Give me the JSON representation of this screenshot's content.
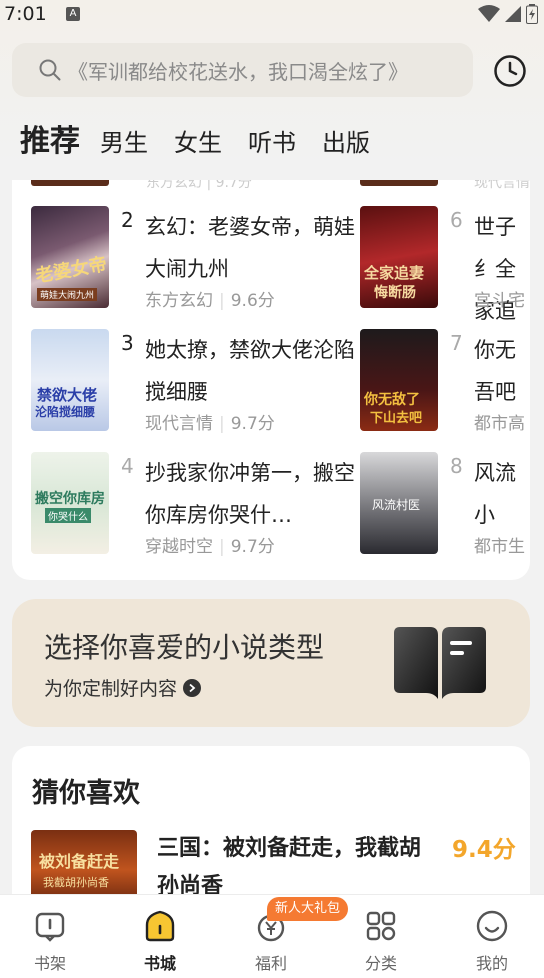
{
  "status_bar": {
    "time": "7:01",
    "notification_badge": "A"
  },
  "search": {
    "placeholder": "《军训都给校花送水，我口渴全炫了》"
  },
  "tabs": [
    {
      "label": "推荐",
      "active": true
    },
    {
      "label": "男生"
    },
    {
      "label": "女生"
    },
    {
      "label": "听书"
    },
    {
      "label": "出版"
    }
  ],
  "ranking": {
    "peek_left_meta": "东方玄幻 | 9.7分",
    "peek_right_meta": "现代言情",
    "left": [
      {
        "rank": "2",
        "title": "玄幻：老婆女帝，萌娃大闹九州",
        "genre": "东方玄幻",
        "score": "9.6分",
        "cover_text": "老婆女帝",
        "cover_sub": "萌娃大闹九州"
      },
      {
        "rank": "3",
        "title": "她太撩，禁欲大佬沦陷搅细腰",
        "genre": "现代言情",
        "score": "9.7分",
        "cover_text": "禁欲大佬",
        "cover_sub": "沦陷搅细腰"
      },
      {
        "rank": "4",
        "title": "抄我家你冲第一，搬空你库房你哭什…",
        "genre": "穿越时空",
        "score": "9.7分",
        "cover_text": "搬空你库房",
        "cover_sub": "你哭什么"
      }
    ],
    "right": [
      {
        "rank": "6",
        "title": "世子纟全家追",
        "genre": "宫斗宅",
        "cover_text": "全家追妻",
        "cover_sub": "悔断肠"
      },
      {
        "rank": "7",
        "title": "你无吾吧",
        "genre": "都市高",
        "cover_text": "你无敌了",
        "cover_sub": "下山去吧"
      },
      {
        "rank": "8",
        "title": "风流小",
        "genre": "都市生",
        "cover_text": "风流村医",
        "cover_sub": ""
      }
    ]
  },
  "category_banner": {
    "title": "选择你喜爱的小说类型",
    "subtitle": "为你定制好内容"
  },
  "guess": {
    "heading": "猜你喜欢",
    "book": {
      "title": "三国：被刘备赶走，我截胡孙尚香",
      "score": "9.4分",
      "cover_text": "被刘备赶走",
      "cover_sub": "我截胡孙尚香"
    }
  },
  "bottom_nav": {
    "badge": "新人大礼包",
    "items": [
      {
        "label": "书架",
        "icon": "bookshelf-icon"
      },
      {
        "label": "书城",
        "icon": "bookstore-icon",
        "active": true
      },
      {
        "label": "福利",
        "icon": "welfare-icon"
      },
      {
        "label": "分类",
        "icon": "category-icon"
      },
      {
        "label": "我的",
        "icon": "profile-icon"
      }
    ]
  },
  "colors": {
    "accent_score": "#f3a62b",
    "badge": "#f57a32",
    "banner_bg": "#efe6d8"
  }
}
